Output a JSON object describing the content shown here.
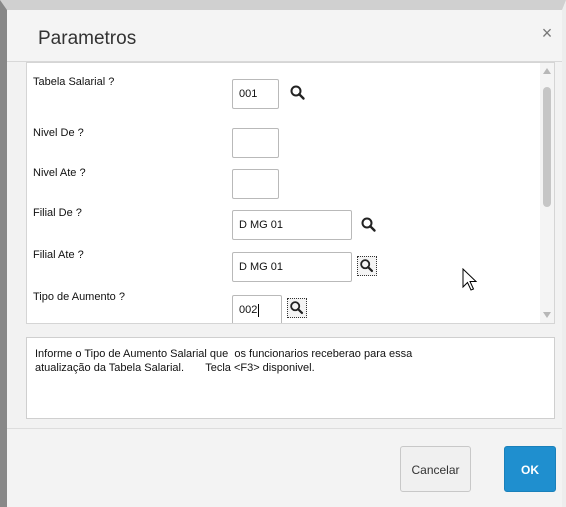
{
  "dialog": {
    "title": "Parametros",
    "close_glyph": "×"
  },
  "params": [
    {
      "label": "Tabela Salarial ?",
      "value": "001",
      "has_lookup": true
    },
    {
      "label": "Nivel De ?",
      "value": "",
      "has_lookup": false
    },
    {
      "label": "Nivel Ate ?",
      "value": "",
      "has_lookup": false
    },
    {
      "label": "Filial De ?",
      "value": "D MG 01",
      "has_lookup": true
    },
    {
      "label": "Filial Ate ?",
      "value": "D MG 01",
      "has_lookup": true
    },
    {
      "label": "Tipo de Aumento ?",
      "value": "002",
      "has_lookup": true
    }
  ],
  "help": {
    "line1": "Informe o Tipo de Aumento Salarial que  os funcionarios receberao para essa",
    "line2": "atualização da Tabela Salarial.       Tecla <F3> disponivel."
  },
  "footer": {
    "cancel_label": "Cancelar",
    "ok_label": "OK"
  },
  "colors": {
    "ok_button": "#1f8fcf",
    "dialog_background": "#f2f2f2"
  },
  "icons": {
    "lookup": "magnifier-icon",
    "close": "close-icon",
    "pointer": "mouse-pointer-icon"
  }
}
